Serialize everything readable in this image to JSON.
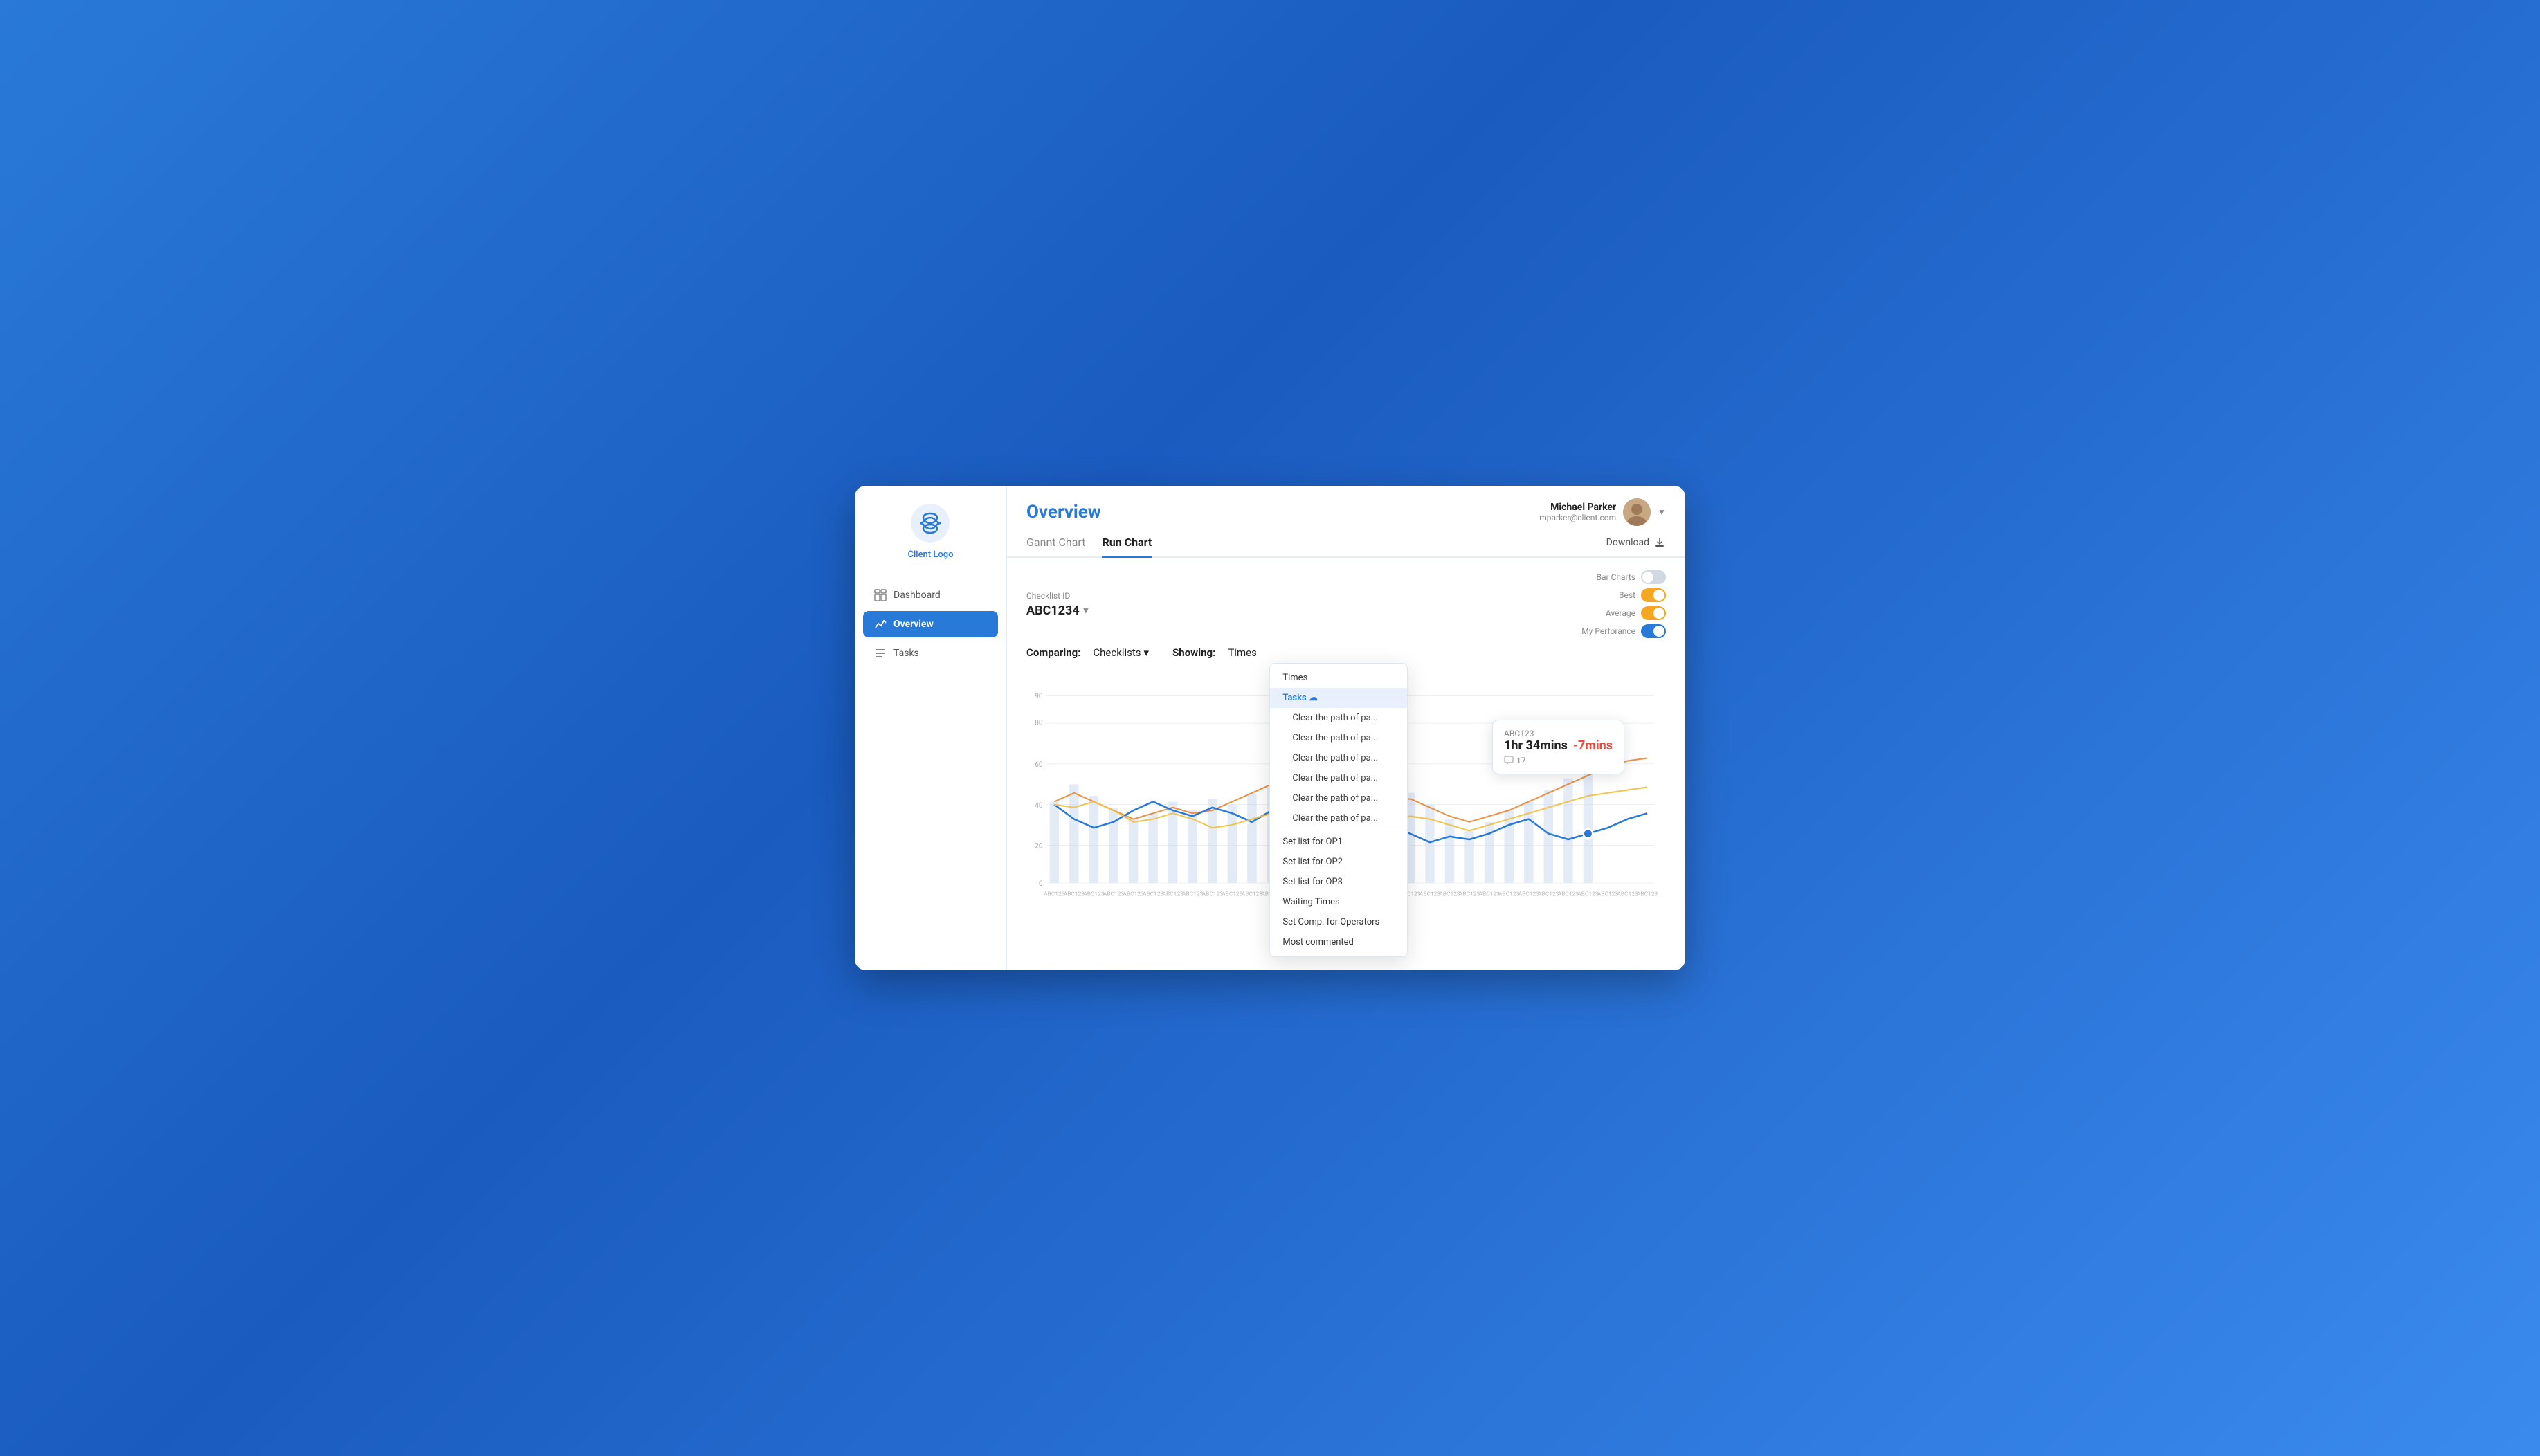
{
  "sidebar": {
    "logo_label": "Client Logo",
    "nav_items": [
      {
        "id": "dashboard",
        "label": "Dashboard",
        "active": false
      },
      {
        "id": "overview",
        "label": "Overview",
        "active": true
      },
      {
        "id": "tasks",
        "label": "Tasks",
        "active": false
      }
    ]
  },
  "header": {
    "title": "Overview",
    "user": {
      "name": "Michael Parker",
      "email": "mparker@client.com"
    }
  },
  "tabs": [
    {
      "id": "gantt",
      "label": "Gannt Chart",
      "active": false
    },
    {
      "id": "run",
      "label": "Run Chart",
      "active": true
    }
  ],
  "download_label": "Download",
  "checklist": {
    "label": "Checklist ID",
    "value": "ABC1234"
  },
  "comparing": {
    "label": "Comparing:",
    "value": "Checklists"
  },
  "showing": {
    "label": "Showing:",
    "value": "Times"
  },
  "toggles": [
    {
      "id": "bar_charts",
      "label": "Bar Charts",
      "state": "off"
    },
    {
      "id": "best",
      "label": "Best",
      "state": "on-orange"
    },
    {
      "id": "average",
      "label": "Average",
      "state": "on-orange"
    },
    {
      "id": "my_performance",
      "label": "My Perforance",
      "state": "on-blue"
    }
  ],
  "dropdown": {
    "items": [
      {
        "id": "times",
        "label": "Times",
        "type": "normal"
      },
      {
        "id": "tasks",
        "label": "Tasks ☁",
        "type": "header"
      },
      {
        "id": "sub1",
        "label": "Clear the path of pa...",
        "type": "sub"
      },
      {
        "id": "sub2",
        "label": "Clear the path of pa...",
        "type": "sub"
      },
      {
        "id": "sub3",
        "label": "Clear the path of pa...",
        "type": "sub"
      },
      {
        "id": "sub4",
        "label": "Clear the path of pa...",
        "type": "sub"
      },
      {
        "id": "sub5",
        "label": "Clear the path of pa...",
        "type": "sub"
      },
      {
        "id": "sub6",
        "label": "Clear the path of pa...",
        "type": "sub"
      },
      {
        "id": "op1",
        "label": "Set list for OP1",
        "type": "normal"
      },
      {
        "id": "op2",
        "label": "Set list for OP2",
        "type": "normal"
      },
      {
        "id": "op3",
        "label": "Set list for OP3",
        "type": "normal"
      },
      {
        "id": "waiting",
        "label": "Waiting Times",
        "type": "normal"
      },
      {
        "id": "comp_op",
        "label": "Set Comp. for Operators",
        "type": "normal"
      },
      {
        "id": "most_commented",
        "label": "Most commented",
        "type": "normal"
      }
    ]
  },
  "chart": {
    "y_labels": [
      "90",
      "80",
      "60",
      "40",
      "20",
      "0"
    ],
    "x_labels": [
      "ABC123",
      "ABC123",
      "ABC123",
      "ABC123",
      "ABC123",
      "ABC123",
      "ABC123",
      "ABC123",
      "ABC123",
      "ABC123",
      "ABC123",
      "ABC123",
      "ABC123",
      "ABC123",
      "ABC123",
      "ABC123",
      "ABC123",
      "ABC123",
      "ABC123",
      "ABC123",
      "ABC123",
      "ABC123",
      "ABC123",
      "ABC123",
      "ABC123",
      "ABC123",
      "ABC123",
      "ABC123"
    ]
  },
  "tooltip": {
    "id": "ABC123",
    "time": "1hr 34mins",
    "delta": "-7mins",
    "comments_count": "17"
  }
}
